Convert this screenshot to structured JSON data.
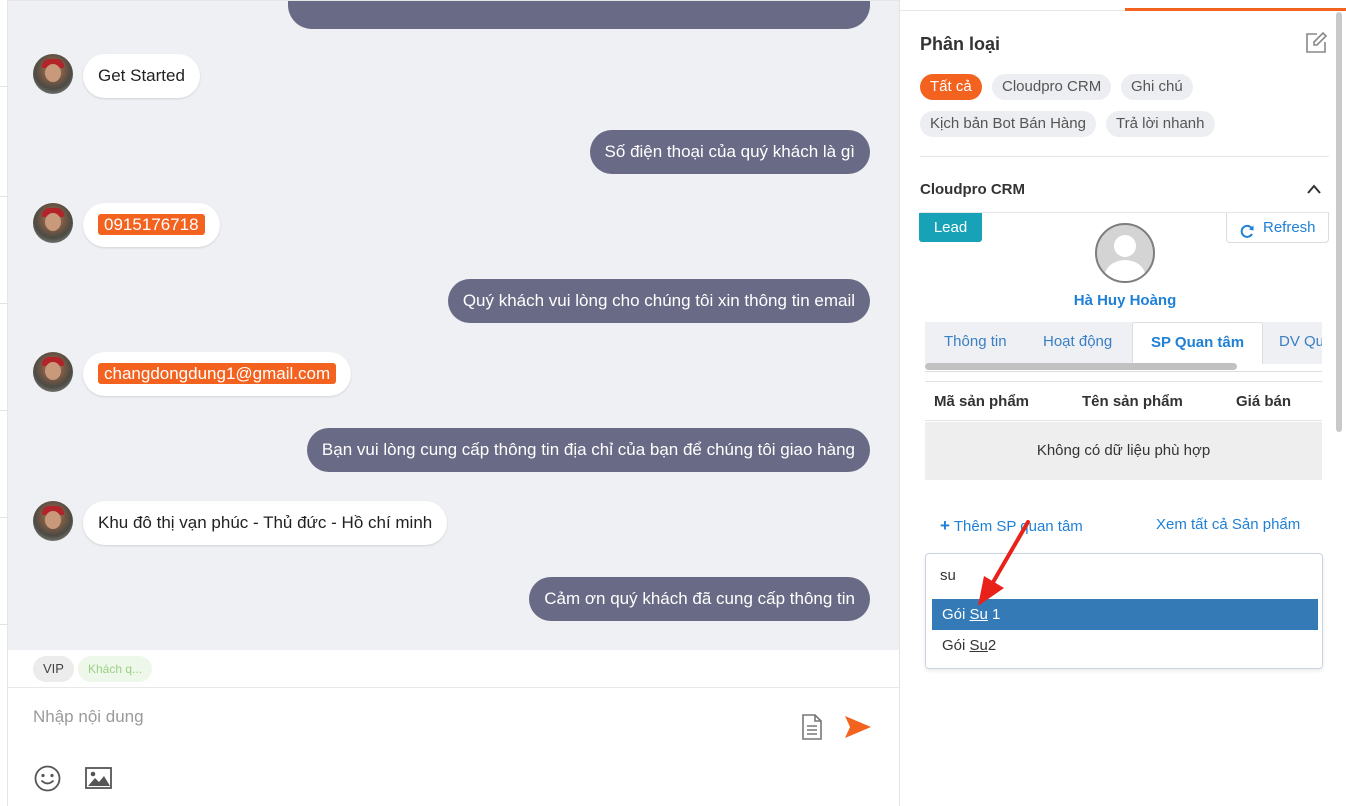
{
  "chat": {
    "messages": [
      {
        "dir": "in",
        "text": "Get Started"
      },
      {
        "dir": "out",
        "text": "Số điện thoại của quý khách là gì"
      },
      {
        "dir": "in",
        "text": "0915176718",
        "highlight": true
      },
      {
        "dir": "out",
        "text": "Quý khách vui lòng cho chúng tôi xin thông tin email"
      },
      {
        "dir": "in",
        "text": "changdongdung1@gmail.com",
        "highlight": true
      },
      {
        "dir": "out",
        "text": "Bạn vui lòng cung cấp thông tin địa chỉ của bạn để chúng tôi giao hàng"
      },
      {
        "dir": "in",
        "text": "Khu đô thị vạn phúc - Thủ đức - Hồ chí minh"
      },
      {
        "dir": "out",
        "text": "Cảm ơn quý khách đã cung cấp thông tin"
      }
    ],
    "tags": [
      "VIP",
      "Khách q..."
    ],
    "composer_placeholder": "Nhập nội dung"
  },
  "colors": {
    "accent": "#f4621f",
    "outgoing_bubble": "#696a85",
    "link": "#1f80d6",
    "lead_badge": "#17a2b8",
    "selected_option": "#337ab7"
  },
  "panel": {
    "classify_title": "Phân loại",
    "chips": [
      "Tất cả",
      "Cloudpro CRM",
      "Ghi chú",
      "Kịch bản Bot Bán Hàng",
      "Trả lời nhanh"
    ],
    "active_chip": "Tất cả",
    "crm_title": "Cloudpro CRM",
    "lead_label": "Lead",
    "refresh_label": "Refresh",
    "contact_name": "Hà Huy Hoàng",
    "tabs": [
      "Thông tin",
      "Hoạt động",
      "SP Quan tâm",
      "DV Quan tâm"
    ],
    "active_tab": "SP Quan tâm",
    "table": {
      "headers": [
        "Mã sản phẩm",
        "Tên sản phẩm",
        "Giá bán"
      ],
      "empty_text": "Không có dữ liệu phù hợp"
    },
    "add_link": "Thêm SP quan tâm",
    "view_all_link": "Xem tất cả Sản phẩm",
    "search": {
      "value": "su",
      "options": [
        {
          "prefix": "Gói ",
          "match": "Su",
          "suffix": " 1",
          "selected": true
        },
        {
          "prefix": "Gói ",
          "match": "Su",
          "suffix": "2",
          "selected": false
        }
      ]
    }
  }
}
